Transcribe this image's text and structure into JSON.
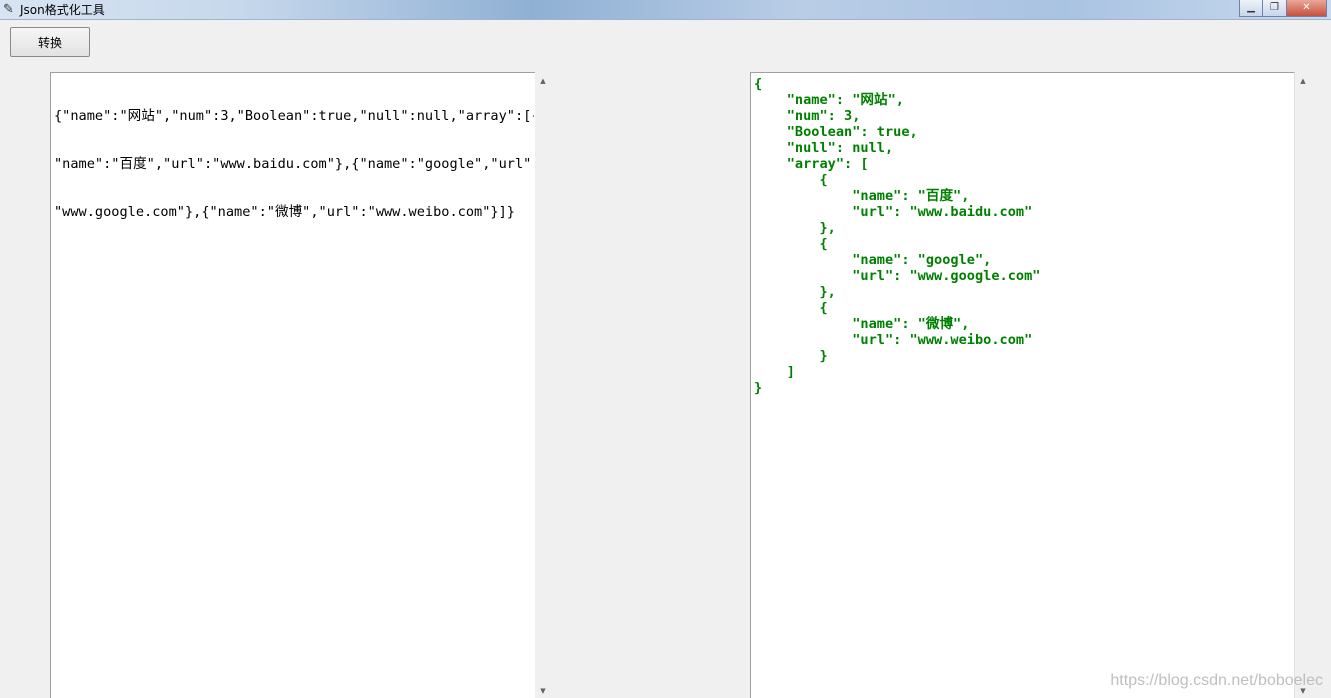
{
  "window": {
    "title": "Json格式化工具",
    "icon": "feather-pen-icon",
    "controls": {
      "minimize": "▁",
      "maximize": "❐",
      "close": "✕"
    }
  },
  "toolbar": {
    "convert_label": "转换"
  },
  "input": {
    "lines": [
      "{\"name\":\"网站\",\"num\":3,\"Boolean\":true,\"null\":null,\"array\":[{",
      "\"name\":\"百度\",\"url\":\"www.baidu.com\"},{\"name\":\"google\",\"url\":",
      "\"www.google.com\"},{\"name\":\"微博\",\"url\":\"www.weibo.com\"}]}"
    ]
  },
  "output": {
    "text_color": "#008000",
    "text": "{\n    \"name\": \"网站\",\n    \"num\": 3,\n    \"Boolean\": true,\n    \"null\": null,\n    \"array\": [\n        {\n            \"name\": \"百度\",\n            \"url\": \"www.baidu.com\"\n        },\n        {\n            \"name\": \"google\",\n            \"url\": \"www.google.com\"\n        },\n        {\n            \"name\": \"微博\",\n            \"url\": \"www.weibo.com\"\n        }\n    ]\n}"
  },
  "scrollbars": {
    "up_arrow": "▲",
    "down_arrow": "▼"
  },
  "watermark": "https://blog.csdn.net/boboelec"
}
